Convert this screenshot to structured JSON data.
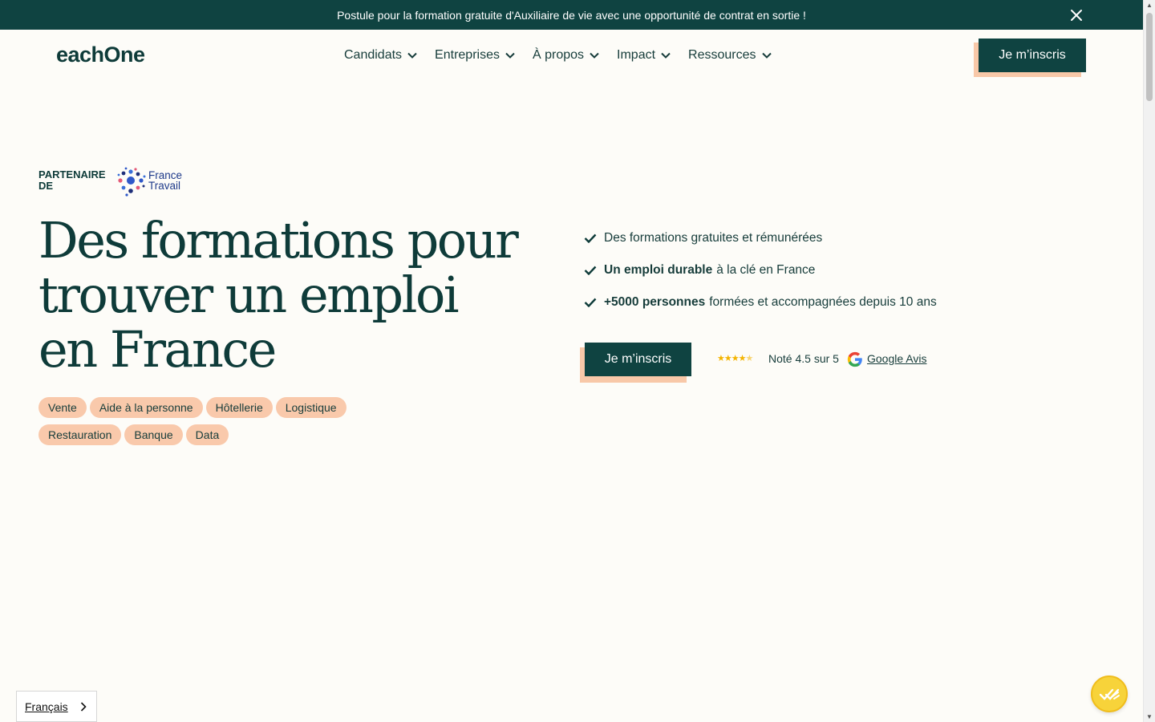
{
  "announcement": {
    "text": "Postule pour la formation gratuite d'Auxiliaire de vie avec une opportunité de contrat en sortie !",
    "close_icon": "close-icon"
  },
  "header": {
    "logo": "eachOne",
    "nav": [
      {
        "label": "Candidats"
      },
      {
        "label": "Entreprises"
      },
      {
        "label": "À propos"
      },
      {
        "label": "Impact"
      },
      {
        "label": "Ressources"
      }
    ],
    "cta_label": "Je m’inscris"
  },
  "partner": {
    "label_line1": "PARTENAIRE",
    "label_line2": "DE",
    "logo_line1": "France",
    "logo_line2": "Travail"
  },
  "hero": {
    "title_line1": "Des formations pour",
    "title_line2": "trouver un emploi",
    "title_line3": "en France",
    "tags_row1": [
      "Vente",
      "Aide à la personne",
      "Hôtellerie",
      "Logistique"
    ],
    "tags_row2": [
      "Restauration",
      "Banque",
      "Data"
    ],
    "bullets": [
      {
        "bold": "",
        "text": "Des formations gratuites et rémunérées"
      },
      {
        "bold": "Un emploi durable",
        "text": "à la clé en France"
      },
      {
        "bold": "+5000 personnes",
        "text": "formées et accompagnées depuis 10 ans"
      }
    ],
    "cta_label": "Je m’inscris",
    "rating": {
      "stars": 4.5,
      "text": "Noté 4.5 sur 5",
      "link_label": "Google Avis"
    }
  },
  "language": {
    "selected": "Français"
  },
  "colors": {
    "primary": "#0f4341",
    "accent": "#f9c9ab",
    "background": "#fdfcf8",
    "chat_widget": "#f7d33a"
  }
}
